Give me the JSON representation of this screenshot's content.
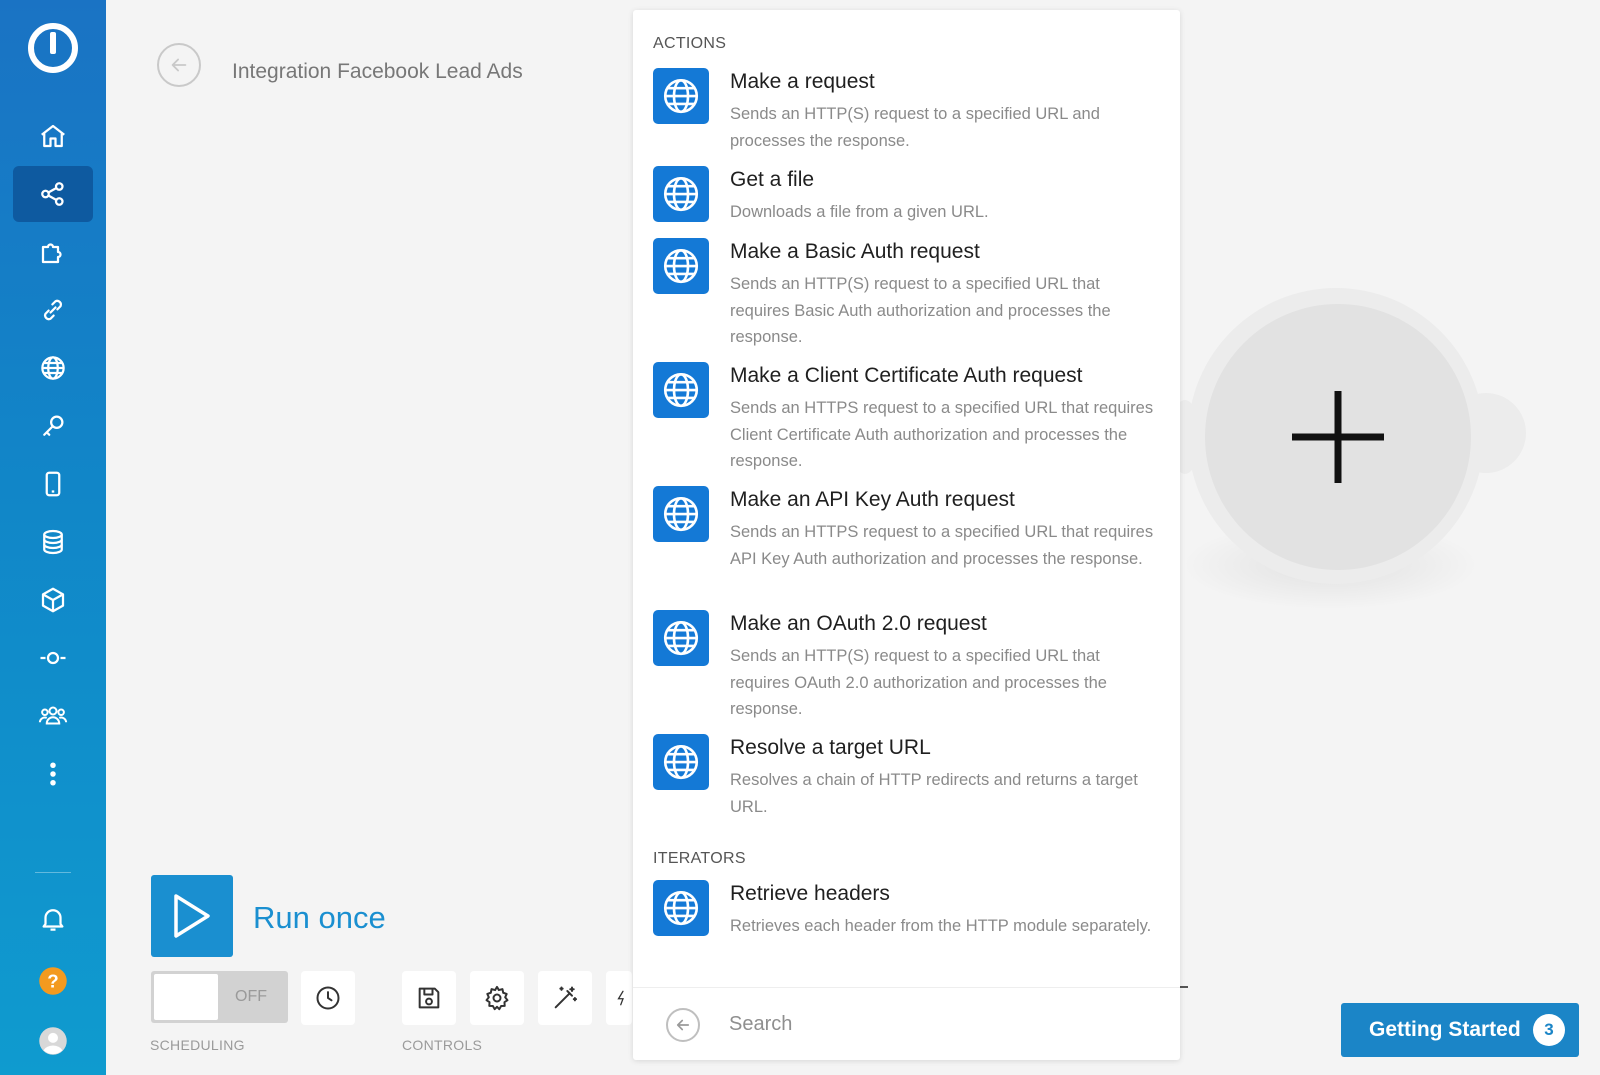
{
  "scenario": {
    "title": "Integration Facebook Lead Ads"
  },
  "sidebar": {
    "items": [
      {
        "icon": "home-icon"
      },
      {
        "icon": "share-icon",
        "active": true
      },
      {
        "icon": "puzzle-icon"
      },
      {
        "icon": "link-icon"
      },
      {
        "icon": "globe-icon"
      },
      {
        "icon": "key-icon"
      },
      {
        "icon": "mobile-icon"
      },
      {
        "icon": "database-icon"
      },
      {
        "icon": "cube-icon"
      },
      {
        "icon": "webhook-icon"
      },
      {
        "icon": "team-icon"
      },
      {
        "icon": "more-icon"
      }
    ],
    "bottom": [
      {
        "icon": "bell-icon"
      },
      {
        "icon": "help-icon",
        "text": "?"
      },
      {
        "icon": "avatar-icon"
      }
    ]
  },
  "panel": {
    "sections": {
      "actions": "ACTIONS",
      "iterators": "ITERATORS"
    },
    "actions": [
      {
        "name": "Make a request",
        "desc": "Sends an HTTP(S) request to a specified URL and processes the response."
      },
      {
        "name": "Get a file",
        "desc": "Downloads a file from a given URL."
      },
      {
        "name": "Make a Basic Auth request",
        "desc": "Sends an HTTP(S) request to a specified URL that requires Basic Auth authorization and processes the response."
      },
      {
        "name": "Make a Client Certificate Auth request",
        "desc": "Sends an HTTPS request to a specified URL that requires Client Certificate Auth authorization and processes the response."
      },
      {
        "name": "Make an API Key Auth request",
        "desc": "Sends an HTTPS request to a specified URL that requires API Key Auth authorization and processes the response."
      },
      {
        "name": "Make an OAuth 2.0 request",
        "desc": "Sends an HTTP(S) request to a specified URL that requires OAuth 2.0 authorization and processes the response."
      },
      {
        "name": "Resolve a target URL",
        "desc": "Resolves a chain of HTTP redirects and returns a target URL."
      }
    ],
    "iterators": [
      {
        "name": "Retrieve headers",
        "desc": "Retrieves each header from the HTTP module separately."
      }
    ],
    "search": {
      "placeholder": "Search"
    }
  },
  "run": {
    "label": "Run once"
  },
  "scheduling": {
    "toggle_label": "OFF",
    "group_label": "SCHEDULING"
  },
  "controls": {
    "group_label": "CONTROLS"
  },
  "getting_started": {
    "label": "Getting Started",
    "count": "3"
  },
  "colors": {
    "sidebar": "#1186c8",
    "accent": "#1a8fd0",
    "module_icon": "#1479d6"
  }
}
